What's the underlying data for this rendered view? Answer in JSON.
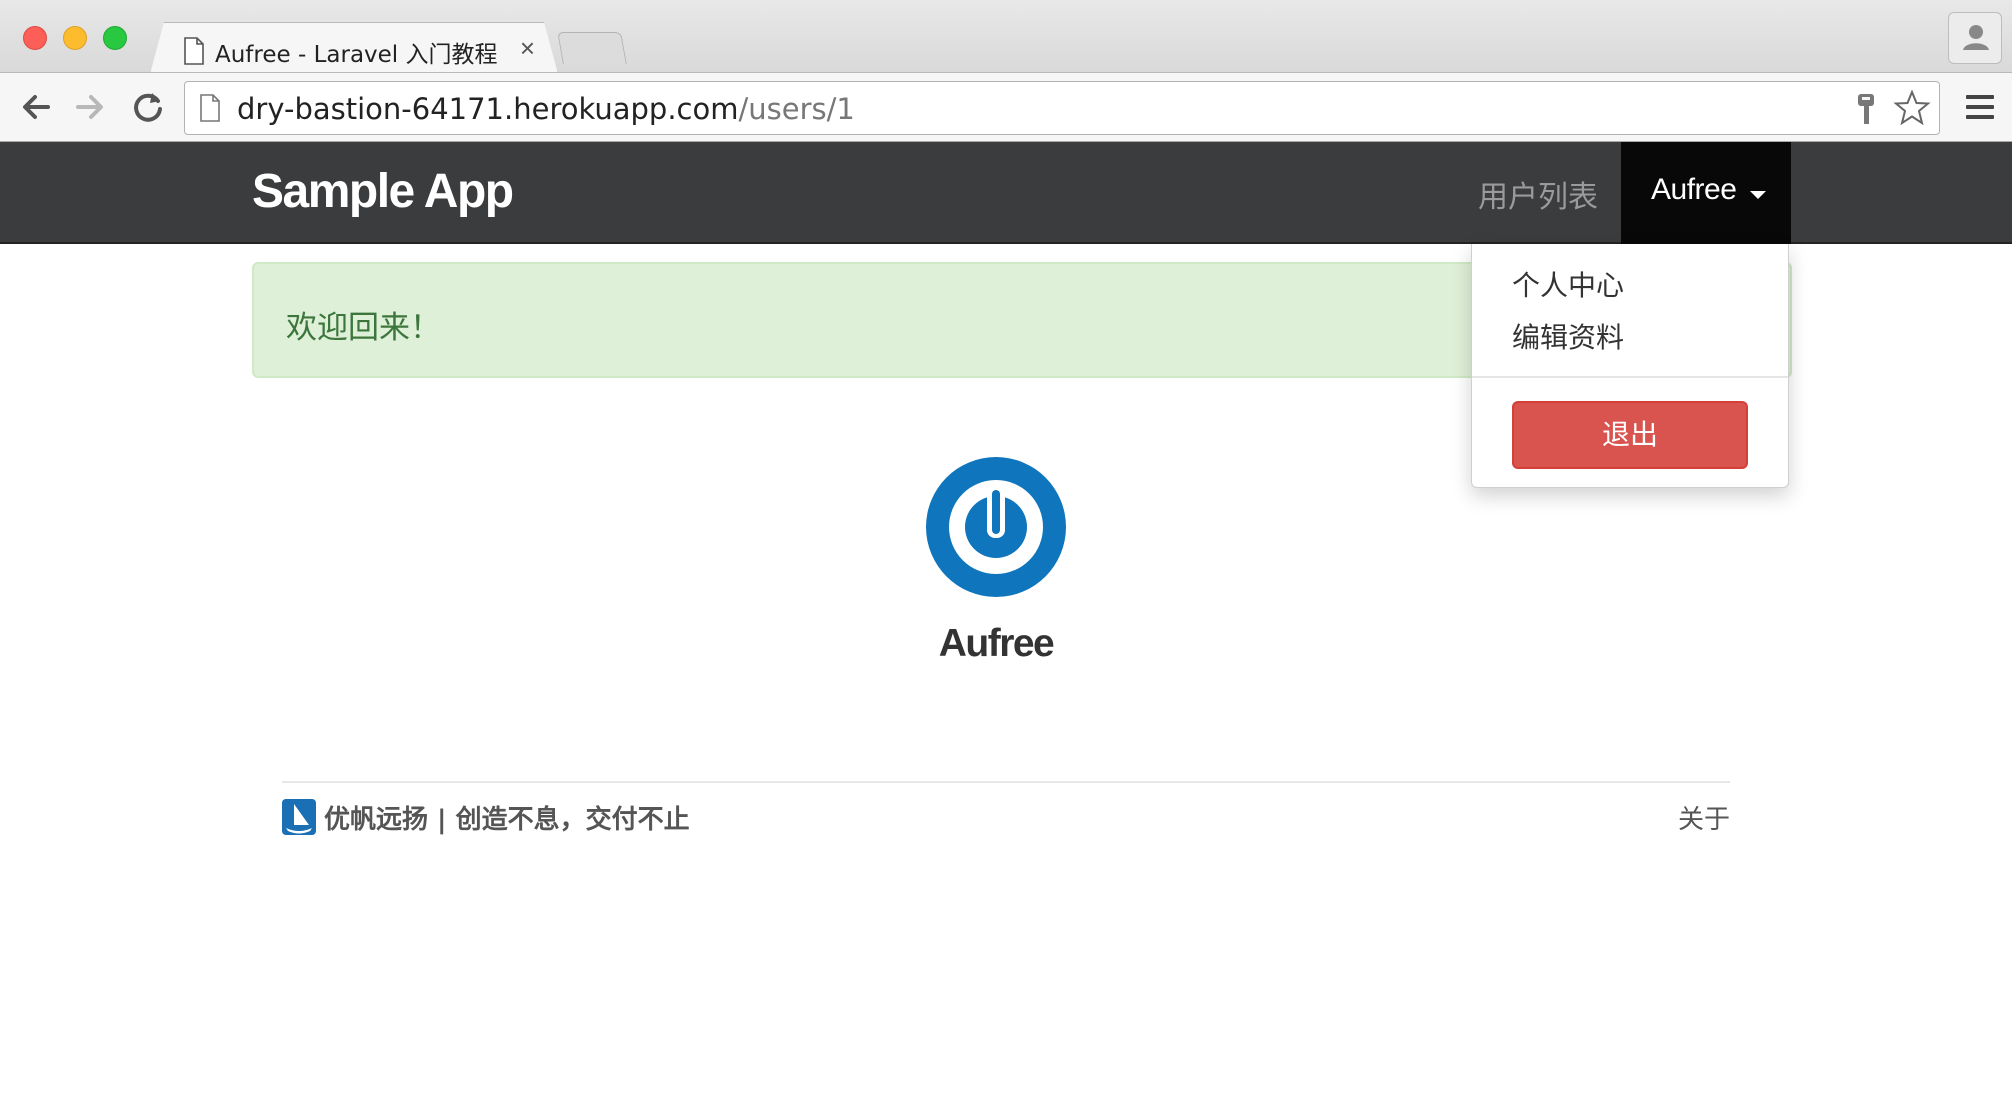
{
  "browser": {
    "tab_title": "Aufree - Laravel 入门教程",
    "tab_close": "×",
    "url_host": "dry-bastion-64171.herokuapp.com",
    "url_path": "/users/1"
  },
  "navbar": {
    "brand": "Sample App",
    "users_link": "用户列表",
    "user_menu_label": "Aufree"
  },
  "dropdown": {
    "items": [
      "个人中心",
      "编辑资料"
    ],
    "logout_label": "退出"
  },
  "alert": {
    "message": "欢迎回来！",
    "color": "#3c763d",
    "background": "#dff0d8"
  },
  "profile": {
    "name": "Aufree",
    "avatar_icon": "power-icon"
  },
  "footer": {
    "tagline": "优帆远扬 | 创造不息，交付不止",
    "about": "关于"
  },
  "colors": {
    "navbar": "#3b3c3e",
    "logout_button": "#d9534f",
    "avatar_blue": "#0f75bc"
  }
}
